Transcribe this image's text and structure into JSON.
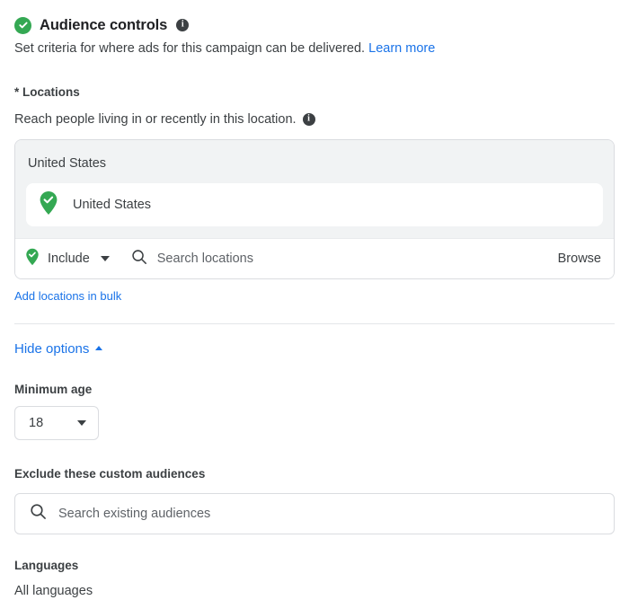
{
  "header": {
    "status_icon": "check-circle-icon",
    "title": "Audience controls",
    "info_icon": "info-icon",
    "description": "Set criteria for where ads for this campaign can be delivered.",
    "learn_more_label": "Learn more"
  },
  "locations": {
    "label": "* Locations",
    "reach_text": "Reach people living in or recently in this location.",
    "reach_info_icon": "info-icon",
    "panel_title": "United States",
    "selected": [
      {
        "name": "United States",
        "icon": "location-pin-check-icon"
      }
    ],
    "include_control": {
      "icon": "location-pin-check-icon",
      "label": "Include",
      "caret_icon": "chevron-down-icon"
    },
    "search": {
      "icon": "search-icon",
      "placeholder": "Search locations"
    },
    "browse_label": "Browse",
    "bulk_link_label": "Add locations in bulk"
  },
  "options_toggle": {
    "label": "Hide options",
    "caret_icon": "chevron-up-icon"
  },
  "minimum_age": {
    "label": "Minimum age",
    "value": "18",
    "caret_icon": "chevron-down-icon"
  },
  "exclude_audiences": {
    "label": "Exclude these custom audiences",
    "search_icon": "search-icon",
    "placeholder": "Search existing audiences"
  },
  "languages": {
    "label": "Languages",
    "value": "All languages"
  },
  "colors": {
    "green": "#34a853",
    "link_blue": "#1a73e8",
    "panel_gray": "#f1f3f4",
    "text": "#3c4043",
    "border": "#dadce0"
  }
}
